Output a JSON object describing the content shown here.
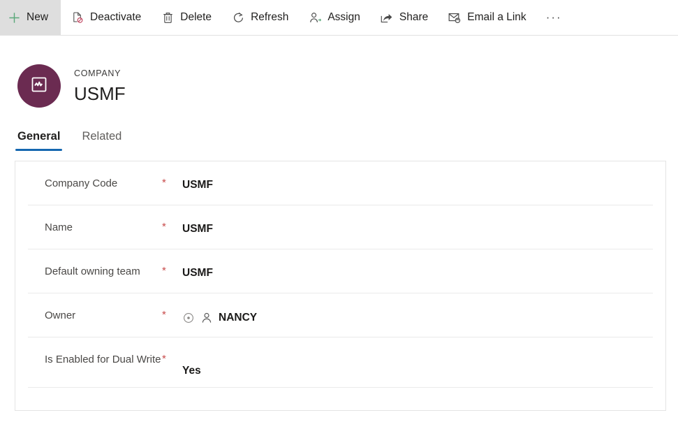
{
  "commandbar": {
    "buttons": [
      {
        "label": "New",
        "icon": "plus-icon",
        "primary": true
      },
      {
        "label": "Deactivate",
        "icon": "deactivate-document-icon",
        "primary": false
      },
      {
        "label": "Delete",
        "icon": "trash-icon",
        "primary": false
      },
      {
        "label": "Refresh",
        "icon": "refresh-icon",
        "primary": false
      },
      {
        "label": "Assign",
        "icon": "assign-person-icon",
        "primary": false
      },
      {
        "label": "Share",
        "icon": "share-icon",
        "primary": false
      },
      {
        "label": "Email a Link",
        "icon": "email-link-icon",
        "primary": false
      }
    ],
    "overflow_label": "···",
    "overflow_icon": "more-ellipsis-icon"
  },
  "entity": {
    "kicker": "COMPANY",
    "title": "USMF",
    "avatar_icon": "company-chart-icon",
    "avatar_color": "#6b2b51"
  },
  "tabs": [
    {
      "label": "General",
      "selected": true
    },
    {
      "label": "Related",
      "selected": false
    }
  ],
  "form": {
    "fields": [
      {
        "label": "Company Code",
        "required": "*",
        "value": "USMF",
        "type": "text"
      },
      {
        "label": "Name",
        "required": "*",
        "value": "USMF",
        "type": "text"
      },
      {
        "label": "Default owning team",
        "required": "*",
        "value": "USMF",
        "type": "text"
      },
      {
        "label": "Owner",
        "required": "*",
        "value": "NANCY",
        "type": "lookup"
      },
      {
        "label": "Is Enabled for Dual Write",
        "required": "*",
        "value": "Yes",
        "type": "text"
      }
    ]
  },
  "colors": {
    "accent": "#1567b0",
    "required": "#c84b4b",
    "avatar": "#6b2b51",
    "primary_button_bg": "#dedede"
  }
}
